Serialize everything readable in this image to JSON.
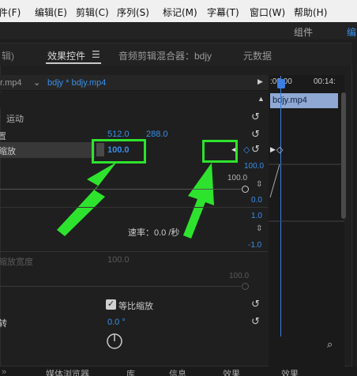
{
  "menu": [
    "件(F)",
    "编辑(E)",
    "剪辑(C)",
    "序列(S)",
    "标记(M)",
    "字幕(T)",
    "窗口(W)",
    "帮助(H)"
  ],
  "workspace": {
    "components": "组件",
    "edit": "编"
  },
  "panel_tabs": {
    "left_fragment": "辑)",
    "effects": "效果控件",
    "audio_mixer": "音频剪辑混合器：bdjy",
    "metadata": "元数据"
  },
  "clip_bar": {
    "source": "r.mp4",
    "sequence": "bdjy * bdjy.mp4",
    "time_start": ":00:00",
    "time_end": "00:14:"
  },
  "clip_name": "bdjy.mp4",
  "motion": {
    "label": "运动"
  },
  "position": {
    "label": "置",
    "x": "512.0",
    "y": "288.0"
  },
  "scale": {
    "label": "缩放",
    "value": "100.0",
    "max": "100.0"
  },
  "graph": {
    "top": "100.0",
    "zero": "0.0",
    "one": "1.0",
    "neg": "-1.0"
  },
  "velocity": {
    "label": "速率：0.0 /秒"
  },
  "scale_width": {
    "label": "缩放宽度",
    "value": "100.0",
    "max": "100.0"
  },
  "uniform_scale": {
    "label": "等比缩放"
  },
  "rotation": {
    "label": "转",
    "value": "0.0 °"
  },
  "bottom_tabs": [
    "媒体浏览器",
    "库",
    "信息",
    "效果",
    "效果"
  ],
  "colors": {
    "accent_blue": "#3a8fe8",
    "highlight_green": "#2ee32e"
  }
}
